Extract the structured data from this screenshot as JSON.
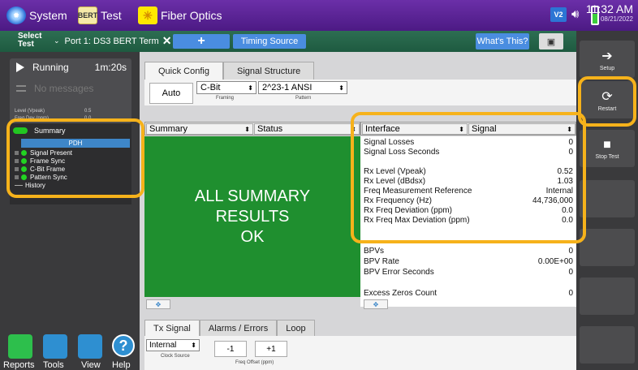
{
  "topbar": {
    "system_label": "System",
    "test_icon_text": "BERT",
    "test_label": "Test",
    "fiber_label": "Fiber Optics",
    "v_badge": "V2",
    "time": "11:32 AM",
    "date": "08/21/2022"
  },
  "tabbar": {
    "select_test_line1": "Select",
    "select_test_line2": "Test",
    "port_tab": "Port 1: DS3 BERT Term",
    "add_tab": "+",
    "timing_source": "Timing Source",
    "whats_this": "What's This?"
  },
  "left": {
    "status": "Running",
    "timer": "1m:20s",
    "messages": "No messages",
    "level_label": "Level (Vpeak)",
    "level_value": "0.5",
    "freq_label": "Freq Dev (ppm)",
    "freq_value": "0.0",
    "tree": {
      "summary": "Summary",
      "pdh": "PDH",
      "items": [
        "Signal Present",
        "Frame Sync",
        "C-Bit Frame",
        "Pattern Sync"
      ],
      "history": "History"
    },
    "bottom": [
      "Reports",
      "Tools",
      "View",
      "Help"
    ]
  },
  "right_buttons": [
    {
      "label": "Setup"
    },
    {
      "label": "Restart"
    },
    {
      "label": "Stop Test"
    }
  ],
  "main": {
    "tabs": [
      "Quick Config",
      "Signal Structure"
    ],
    "auto_btn": "Auto",
    "framing_value": "C-Bit",
    "framing_caption": "Framing",
    "pattern_value": "2^23-1 ANSI",
    "pattern_caption": "Pattern",
    "summary_sel": "Summary",
    "status_sel": "Status",
    "summary_line1": "ALL SUMMARY",
    "summary_line2": "RESULTS",
    "summary_line3": "OK",
    "interface_sel": "Interface",
    "signal_sel": "Signal",
    "results": [
      {
        "label": "Signal Losses",
        "value": "0"
      },
      {
        "label": "Signal Loss Seconds",
        "value": "0"
      },
      {
        "label": "",
        "value": ""
      },
      {
        "label": "Rx Level (Vpeak)",
        "value": "0.52"
      },
      {
        "label": "Rx Level (dBdsx)",
        "value": "1.03"
      },
      {
        "label": "Freq Measurement Reference",
        "value": "Internal"
      },
      {
        "label": "Rx Frequency (Hz)",
        "value": "44,736,000"
      },
      {
        "label": "Rx Freq Deviation (ppm)",
        "value": "0.0"
      },
      {
        "label": "Rx Freq Max Deviation (ppm)",
        "value": "0.0"
      },
      {
        "label": "BPVs",
        "value": "0"
      },
      {
        "label": "BPV Rate",
        "value": "0.00E+00"
      },
      {
        "label": "BPV Error Seconds",
        "value": "0"
      },
      {
        "label": "",
        "value": ""
      },
      {
        "label": "Excess Zeros Count",
        "value": "0"
      }
    ],
    "tx_tabs": [
      "Tx Signal",
      "Alarms / Errors",
      "Loop"
    ],
    "clock_value": "Internal",
    "clock_caption": "Clock Source",
    "minus_btn": "-1",
    "plus_btn": "+1",
    "freq_caption": "Freq Offset (ppm)"
  },
  "accent_color": "#f6b21b"
}
